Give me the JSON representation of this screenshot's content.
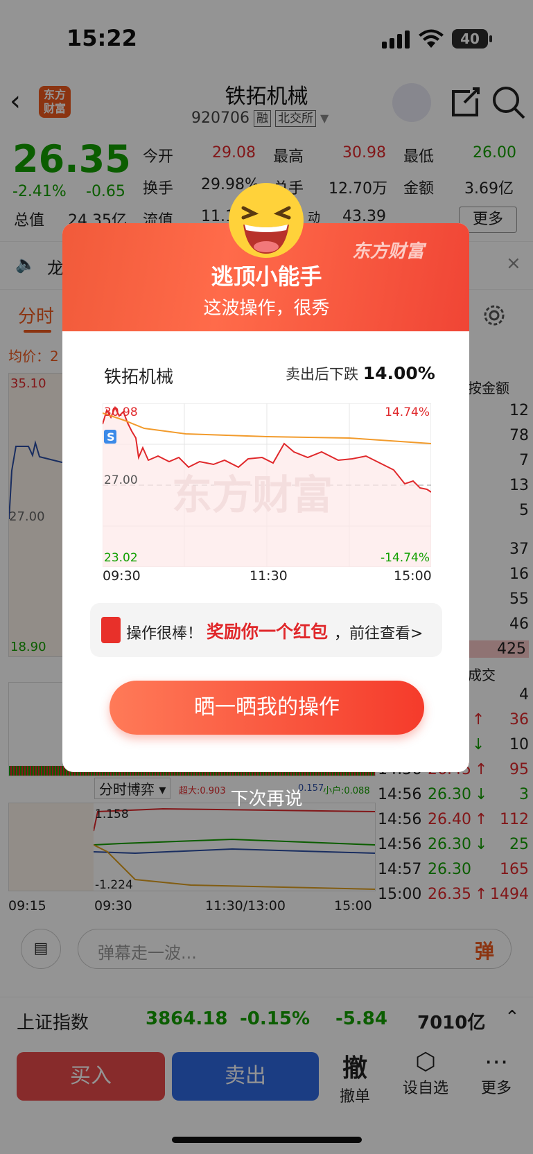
{
  "status": {
    "time": "15:22",
    "battery": "40"
  },
  "header": {
    "back": "‹",
    "logo": "东方\n财富",
    "name": "铁拓机械",
    "code": "920706",
    "tag1": "融",
    "tag2": "北交所"
  },
  "quote": {
    "price": "26.35",
    "pct": "-2.41%",
    "chg": "-0.65",
    "r1": {
      "l1": "今开",
      "v1": "29.08",
      "l2": "最高",
      "v2": "30.98",
      "l3": "最低",
      "v3": "26.00"
    },
    "r2": {
      "l1": "换手",
      "v1": "29.98%",
      "l2": "总手",
      "v2": "12.70万",
      "l3": "金额",
      "v3": "3.69亿"
    },
    "r3": {
      "l1": "总值",
      "v1": "24.35亿",
      "l2": "流值",
      "v2": "11.1",
      "l3": "动",
      "v3": "43.39"
    },
    "more": "更多"
  },
  "ticker": {
    "text": "龙"
  },
  "tabs": {
    "t1": "分时",
    "avg": "均价：2"
  },
  "mainchart": {
    "high": "35.10",
    "mid": "27.00",
    "low": "18.90"
  },
  "side": {
    "header": "按金额",
    "top": [
      "12",
      "78",
      "7",
      "13",
      "5"
    ],
    "bottom": [
      "37",
      "16",
      "55",
      "46",
      "425"
    ],
    "deals_label": "成交",
    "ticks": [
      {
        "t": "",
        "p": "",
        "a": "↑",
        "v": "4"
      },
      {
        "t": "",
        "p": "",
        "a": "↑",
        "v": "36"
      },
      {
        "t": "",
        "p": "",
        "a": "↓",
        "v": "10"
      },
      {
        "t": "14:56",
        "p": "26.45",
        "a": "↑",
        "v": "95"
      },
      {
        "t": "14:56",
        "p": "26.30",
        "a": "↓",
        "v": "3"
      },
      {
        "t": "14:56",
        "p": "26.40",
        "a": "↑",
        "v": "112"
      },
      {
        "t": "14:56",
        "p": "26.30",
        "a": "↓",
        "v": "25"
      },
      {
        "t": "14:57",
        "p": "26.30",
        "a": "",
        "v": "165"
      },
      {
        "t": "15:00",
        "p": "26.35",
        "a": "↑",
        "v": "1494"
      }
    ]
  },
  "game": {
    "label": "分时博弈",
    "big": "超大:0.903",
    "small": "小户:0.088",
    "mid": "0.157",
    "top": "1.158",
    "bottom": "-1.224",
    "x1": "09:15",
    "x2": "09:30",
    "x3": "11:30/13:00",
    "x4": "15:00"
  },
  "danmu": {
    "placeholder": "弹幕走一波...",
    "btn": "弹"
  },
  "index": {
    "name": "上证指数",
    "value": "3864.18",
    "pct": "-0.15%",
    "chg": "-5.84",
    "amount": "7010亿"
  },
  "bottom": {
    "buy": "买入",
    "sell": "卖出",
    "cancel_icon": "撤",
    "cancel": "撤单",
    "fav": "设自选",
    "more": "更多"
  },
  "dialog": {
    "title": "逃顶小能手",
    "subtitle": "这波操作，很秀",
    "brand": "东方财富",
    "stock": "铁拓机械",
    "drop_label": "卖出后下跌 ",
    "drop_value": "14.00%",
    "chart": {
      "ymax": "30.98",
      "ymid": "27.00",
      "ymin": "23.02",
      "pmax": "14.74%",
      "pmin": "-14.74%",
      "x1": "09:30",
      "x2": "11:30",
      "x3": "15:00",
      "marker": "S",
      "watermark": "东方财富"
    },
    "reward_a": "操作很棒！",
    "reward_b": "奖励你一个红包",
    "reward_c": "，前往查看>",
    "share": "晒一晒我的操作",
    "later": "下次再说"
  },
  "colors": {
    "up": "#e0282b",
    "down": "#13a000",
    "accent": "#f05a1e"
  }
}
